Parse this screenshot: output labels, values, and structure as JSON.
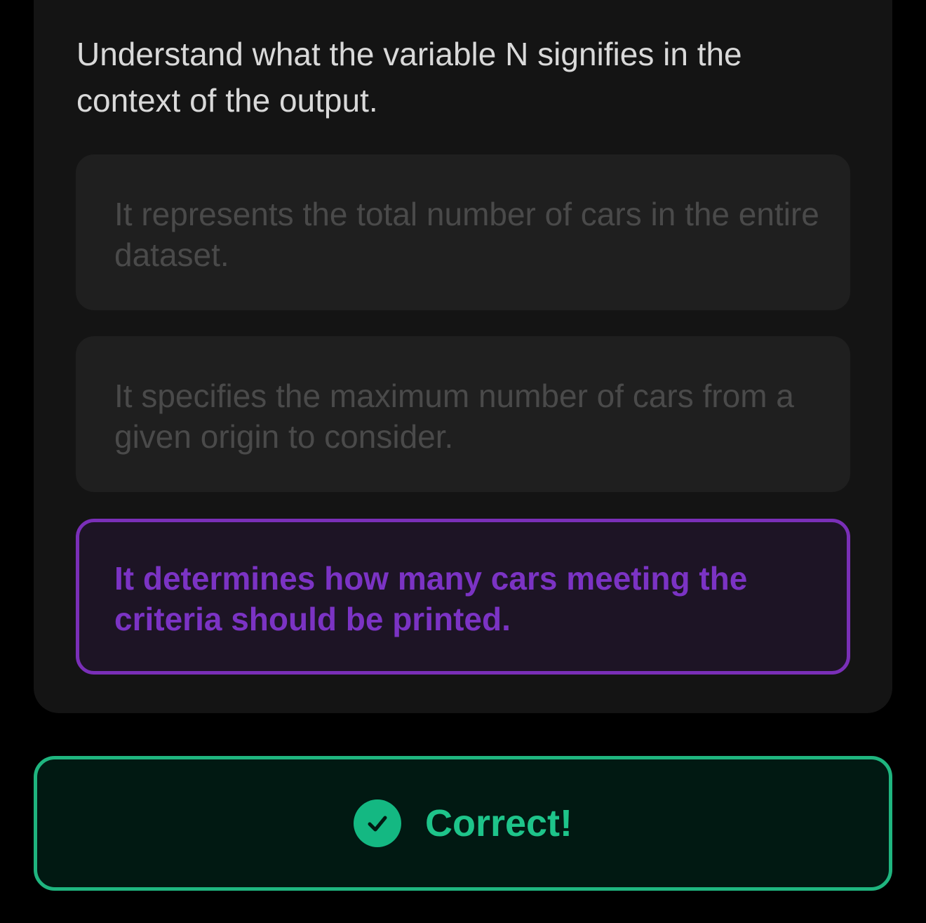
{
  "question": {
    "text": "Understand what the variable N signifies in the context of the output."
  },
  "options": [
    {
      "text": "It represents the total number of cars in the entire dataset.",
      "state": "dimmed"
    },
    {
      "text": "It specifies the maximum number of cars from a given origin to consider.",
      "state": "dimmed"
    },
    {
      "text": "It determines how many cars meeting the criteria should be printed.",
      "state": "selected"
    }
  ],
  "result": {
    "label": "Correct!",
    "icon": "check-circle-icon",
    "color": "#1ec48a"
  },
  "colors": {
    "background": "#000000",
    "card": "#141414",
    "option_bg": "#1f1f1f",
    "selected_border": "#7a2fb8",
    "selected_text": "#7b33c4",
    "success": "#1fb57f"
  }
}
